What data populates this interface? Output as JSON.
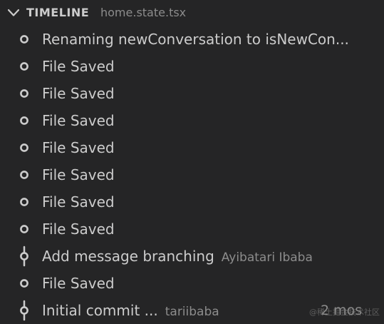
{
  "header": {
    "title": "TIMELINE",
    "file": "home.state.tsx"
  },
  "items": [
    {
      "label": "Renaming newConversation to isNewCon...",
      "author": "",
      "time": "",
      "kind": "local"
    },
    {
      "label": "File Saved",
      "author": "",
      "time": "",
      "kind": "local"
    },
    {
      "label": "File Saved",
      "author": "",
      "time": "",
      "kind": "local"
    },
    {
      "label": "File Saved",
      "author": "",
      "time": "",
      "kind": "local"
    },
    {
      "label": "File Saved",
      "author": "",
      "time": "",
      "kind": "local"
    },
    {
      "label": "File Saved",
      "author": "",
      "time": "",
      "kind": "local"
    },
    {
      "label": "File Saved",
      "author": "",
      "time": "",
      "kind": "local"
    },
    {
      "label": "File Saved",
      "author": "",
      "time": "",
      "kind": "local"
    },
    {
      "label": "Add message branching",
      "author": "Ayibatari Ibaba",
      "time": "",
      "kind": "commit"
    },
    {
      "label": "File Saved",
      "author": "",
      "time": "",
      "kind": "local"
    },
    {
      "label": "Initial commit ...",
      "author": "tariibaba",
      "time": "2 mos",
      "kind": "commit"
    }
  ],
  "watermark": "@稀土掘金技术社区",
  "colors": {
    "background": "#252526",
    "text": "#cccccc",
    "muted": "#8c8c8c"
  },
  "icons": {
    "header": "chevron-down-icon",
    "local": "circle-icon",
    "commit": "git-commit-icon"
  }
}
